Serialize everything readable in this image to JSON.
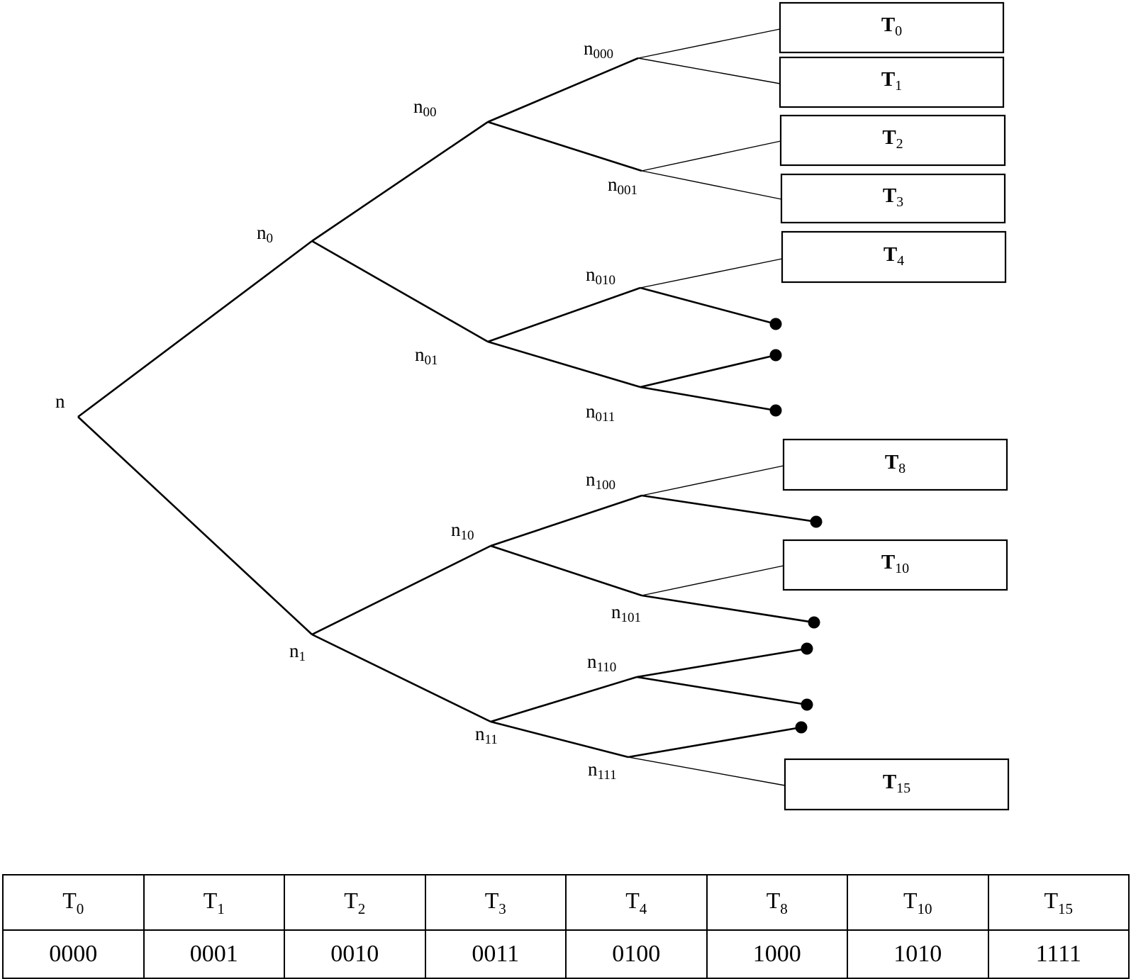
{
  "diagram": {
    "type": "binary-tree",
    "root": "n",
    "nodes": [
      {
        "id": "n",
        "base": "n",
        "sub": ""
      },
      {
        "id": "n0",
        "base": "n",
        "sub": "0"
      },
      {
        "id": "n1",
        "base": "n",
        "sub": "1"
      },
      {
        "id": "n00",
        "base": "n",
        "sub": "00"
      },
      {
        "id": "n01",
        "base": "n",
        "sub": "01"
      },
      {
        "id": "n10",
        "base": "n",
        "sub": "10"
      },
      {
        "id": "n11",
        "base": "n",
        "sub": "11"
      },
      {
        "id": "n000",
        "base": "n",
        "sub": "000"
      },
      {
        "id": "n001",
        "base": "n",
        "sub": "001"
      },
      {
        "id": "n010",
        "base": "n",
        "sub": "010"
      },
      {
        "id": "n011",
        "base": "n",
        "sub": "011"
      },
      {
        "id": "n100",
        "base": "n",
        "sub": "100"
      },
      {
        "id": "n101",
        "base": "n",
        "sub": "101"
      },
      {
        "id": "n110",
        "base": "n",
        "sub": "110"
      },
      {
        "id": "n111",
        "base": "n",
        "sub": "111"
      }
    ],
    "edges": [
      [
        "n",
        "n0"
      ],
      [
        "n",
        "n1"
      ],
      [
        "n0",
        "n00"
      ],
      [
        "n0",
        "n01"
      ],
      [
        "n1",
        "n10"
      ],
      [
        "n1",
        "n11"
      ],
      [
        "n00",
        "n000"
      ],
      [
        "n00",
        "n001"
      ],
      [
        "n01",
        "n010"
      ],
      [
        "n01",
        "n011"
      ],
      [
        "n10",
        "n100"
      ],
      [
        "n10",
        "n101"
      ],
      [
        "n11",
        "n110"
      ],
      [
        "n11",
        "n111"
      ]
    ],
    "leaves": [
      {
        "parent": "n000",
        "kind": "tile",
        "base": "T",
        "sub": "0"
      },
      {
        "parent": "n000",
        "kind": "tile",
        "base": "T",
        "sub": "1"
      },
      {
        "parent": "n001",
        "kind": "tile",
        "base": "T",
        "sub": "2"
      },
      {
        "parent": "n001",
        "kind": "tile",
        "base": "T",
        "sub": "3"
      },
      {
        "parent": "n010",
        "kind": "tile",
        "base": "T",
        "sub": "4"
      },
      {
        "parent": "n010",
        "kind": "empty"
      },
      {
        "parent": "n011",
        "kind": "empty"
      },
      {
        "parent": "n011",
        "kind": "empty"
      },
      {
        "parent": "n100",
        "kind": "tile",
        "base": "T",
        "sub": "8"
      },
      {
        "parent": "n100",
        "kind": "empty"
      },
      {
        "parent": "n101",
        "kind": "tile",
        "base": "T",
        "sub": "10"
      },
      {
        "parent": "n101",
        "kind": "empty"
      },
      {
        "parent": "n110",
        "kind": "empty"
      },
      {
        "parent": "n110",
        "kind": "empty"
      },
      {
        "parent": "n111",
        "kind": "empty"
      },
      {
        "parent": "n111",
        "kind": "tile",
        "base": "T",
        "sub": "15"
      }
    ]
  },
  "table": {
    "headers": [
      {
        "base": "T",
        "sub": "0"
      },
      {
        "base": "T",
        "sub": "1"
      },
      {
        "base": "T",
        "sub": "2"
      },
      {
        "base": "T",
        "sub": "3"
      },
      {
        "base": "T",
        "sub": "4"
      },
      {
        "base": "T",
        "sub": "8"
      },
      {
        "base": "T",
        "sub": "10"
      },
      {
        "base": "T",
        "sub": "15"
      }
    ],
    "codes": [
      "0000",
      "0001",
      "0010",
      "0011",
      "0100",
      "1000",
      "1010",
      "1111"
    ]
  }
}
